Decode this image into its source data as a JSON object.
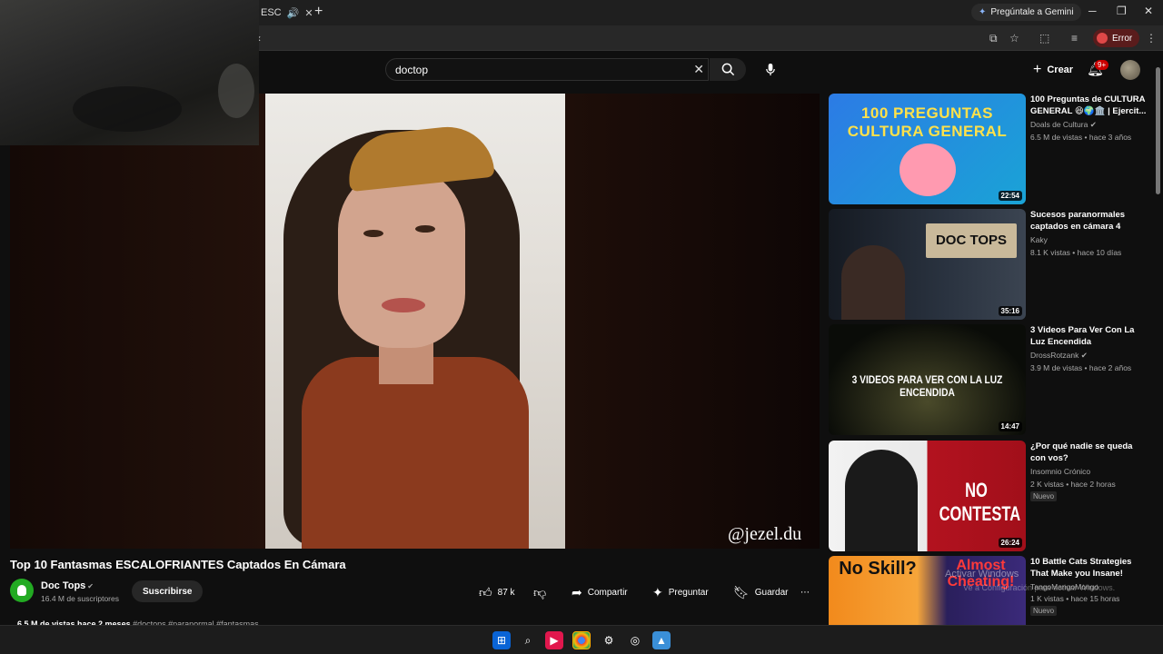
{
  "browser": {
    "tab_title": "ESC",
    "tab_close": "✕",
    "new_tab": "+",
    "gemini_button": "Pregúntale a Gemini",
    "profile_status": "Error"
  },
  "header": {
    "search_value": "doctop",
    "create_label": "Crear",
    "notifications_count": "9+"
  },
  "video": {
    "title": "Top 10 Fantasmas ESCALOFRIANTES Captados En Cámara",
    "watermark": "@jezel.du",
    "channel": "Doc Tops",
    "subscribers": "16.4 M de suscriptores",
    "subscribe_label": "Suscribirse",
    "likes": "87 k",
    "share_label": "Compartir",
    "ask_label": "Preguntar",
    "save_label": "Guardar",
    "more_label": "⋯",
    "views_date": "6.5 M de vistas  hace 2 meses",
    "hashtags": "#doctops #paranormal #fantasmas"
  },
  "recommendations": [
    {
      "title": "100 Preguntas de CULTURA GENERAL 😆🌍🏛️ | Ejercit...",
      "channel": "Doals de Cultura",
      "verified": true,
      "stats": "6.5 M de vistas • hace 3 años",
      "duration": "22:54",
      "thumb_text": "100 PREGUNTAS\nCULTURA GENERAL",
      "badge": ""
    },
    {
      "title": "Sucesos paranormales captados en cámara 4",
      "channel": "Kaky",
      "verified": false,
      "stats": "8.1 K vistas • hace 10 días",
      "duration": "35:16",
      "thumb_text": "DOC TOPS",
      "badge": ""
    },
    {
      "title": "3 Videos Para Ver Con La Luz Encendida",
      "channel": "DrossRotzank",
      "verified": true,
      "stats": "3.9 M de vistas • hace 2 años",
      "duration": "14:47",
      "thumb_text": "3 VIDEOS PARA VER CON LA LUZ ENCENDIDA",
      "badge": ""
    },
    {
      "title": "¿Por qué nadie se queda con vos?",
      "channel": "Insomnio Crónico",
      "verified": false,
      "stats": "2 K vistas • hace 2 horas",
      "duration": "26:24",
      "thumb_text": "NO CONTESTA",
      "badge": "Nuevo"
    },
    {
      "title": "10 Battle Cats Strategies That Make you Insane!",
      "channel": "TangoMangoMongo",
      "verified": false,
      "stats": "1 K vistas • hace 15 horas",
      "duration": "",
      "thumb_text": "No Skill?",
      "thumb_text2": "Almost Cheating!",
      "badge": "Nuevo"
    }
  ],
  "watermark_os": {
    "line1": "Activar Windows",
    "line2": "Ve a Configuración para activar Windows."
  },
  "colors": {
    "background": "#0f0f0f",
    "accent_red": "#cc0000",
    "chip": "#272727"
  }
}
